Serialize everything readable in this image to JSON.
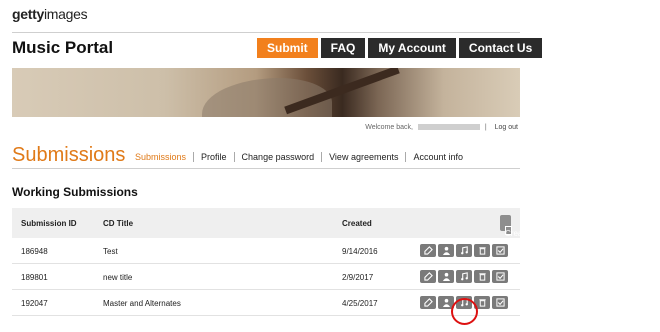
{
  "logo": {
    "bold": "getty",
    "rest": "images"
  },
  "header": {
    "portal_title": "Music Portal"
  },
  "nav": {
    "submit": "Submit",
    "faq": "FAQ",
    "my_account": "My Account",
    "contact_us": "Contact Us",
    "submit_color": "#f2801d"
  },
  "welcome": {
    "text": "Welcome back,",
    "logout": "Log out"
  },
  "page": {
    "title": "Submissions"
  },
  "subnav": [
    "Submissions",
    "Profile",
    "Change password",
    "View agreements",
    "Account info"
  ],
  "section": {
    "title": "Working Submissions"
  },
  "table": {
    "headers": {
      "id": "Submission ID",
      "title": "CD Title",
      "created": "Created"
    },
    "create_button": "Create Submission",
    "rows": [
      {
        "id": "186948",
        "title": "Test",
        "created": "9/14/2016"
      },
      {
        "id": "189801",
        "title": "new title",
        "created": "2/9/2017"
      },
      {
        "id": "192047",
        "title": "Master and Alternates",
        "created": "4/25/2017"
      }
    ]
  },
  "row_actions": [
    "edit-icon",
    "user-icon",
    "music-icon",
    "trash-icon",
    "checkbox-icon"
  ]
}
